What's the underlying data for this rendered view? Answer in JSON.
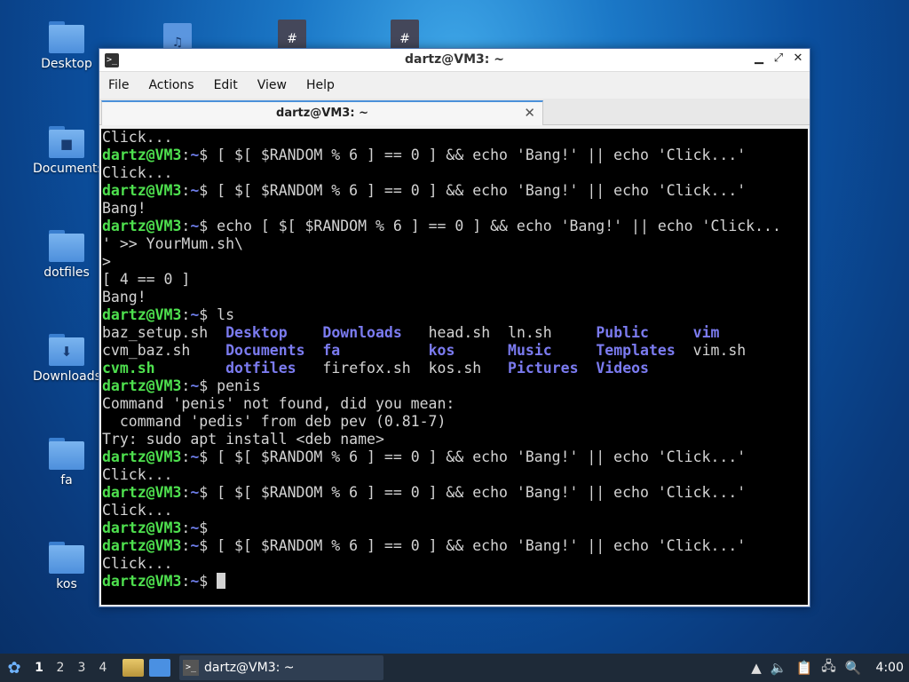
{
  "desktop": {
    "icons": [
      {
        "label": "Desktop",
        "glyph": ""
      },
      {
        "label": "Documents",
        "glyph": "■"
      },
      {
        "label": "dotfiles",
        "glyph": ""
      },
      {
        "label": "Downloads",
        "glyph": "⬇"
      },
      {
        "label": "fa",
        "glyph": ""
      },
      {
        "label": "kos",
        "glyph": ""
      }
    ],
    "top_icons": [
      {
        "glyph": "♫"
      },
      {
        "glyph": "#"
      },
      {
        "glyph": "#"
      }
    ]
  },
  "window": {
    "title": "dartz@VM3: ~",
    "terminal_icon": ">_",
    "controls": {
      "minimize": "▁",
      "maximize": "⤢",
      "close": "✕"
    },
    "menu": [
      "File",
      "Actions",
      "Edit",
      "View",
      "Help"
    ],
    "tab": {
      "label": "dartz@VM3: ~",
      "close": "✕"
    }
  },
  "terminal": {
    "prompt_user": "dartz@VM3",
    "prompt_sep": ":",
    "prompt_path": "~",
    "prompt_dollar": "$ ",
    "lines": [
      "Click...",
      "[ $[ $RANDOM % 6 ] == 0 ] && echo 'Bang!' || echo 'Click...'",
      "Click...",
      "[ $[ $RANDOM % 6 ] == 0 ] && echo 'Bang!' || echo 'Click...'",
      "Bang!",
      "echo [ $[ $RANDOM % 6 ] == 0 ] && echo 'Bang!' || echo 'Click...",
      "' >> YourMum.sh\\",
      ">",
      "[ 4 == 0 ]",
      "Bang!",
      "ls",
      "penis",
      "Command 'penis' not found, did you mean:",
      "  command 'pedis' from deb pev (0.81-7)",
      "Try: sudo apt install <deb name>",
      "[ $[ $RANDOM % 6 ] == 0 ] && echo 'Bang!' || echo 'Click...'",
      "Click...",
      "[ $[ $RANDOM % 6 ] == 0 ] && echo 'Bang!' || echo 'Click...'",
      "Click...",
      "",
      "[ $[ $RANDOM % 6 ] == 0 ] && echo 'Bang!' || echo 'Click...'",
      "Click..."
    ],
    "ls": {
      "row1": [
        "baz_setup.sh",
        "Desktop",
        "Downloads",
        "head.sh",
        "ln.sh",
        "Public",
        "vim"
      ],
      "row2": [
        "cvm_baz.sh",
        "Documents",
        "fa",
        "kos",
        "Music",
        "Templates",
        "vim.sh"
      ],
      "row3": [
        "cvm.sh",
        "dotfiles",
        "firefox.sh",
        "kos.sh",
        "Pictures",
        "Videos"
      ]
    }
  },
  "taskbar": {
    "start_glyph": "✿",
    "workspaces": [
      "1",
      "2",
      "3",
      "4"
    ],
    "task_label": "dartz@VM3: ~",
    "task_icon": ">_",
    "tray": {
      "upload": "▲",
      "volume": "🔈",
      "clipboard": "📋",
      "network": "🖧",
      "update": "🔍"
    },
    "clock": "4:00"
  }
}
